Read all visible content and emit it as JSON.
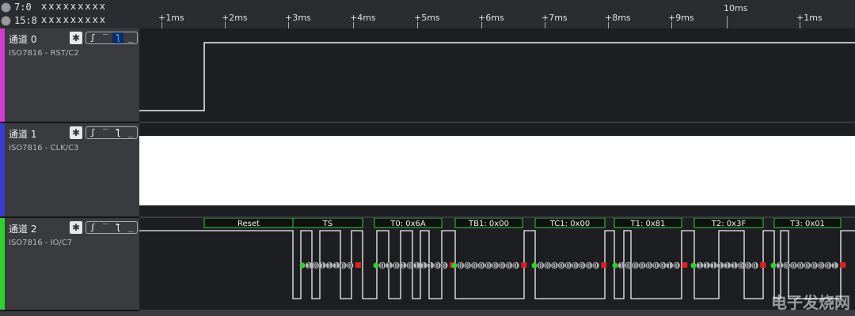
{
  "bus": [
    {
      "label": "7:0",
      "bits": "xxxxxxxxx"
    },
    {
      "label": "15:8",
      "bits": "xxxxxxxxx"
    }
  ],
  "ruler": {
    "ticks": [
      "+1ms",
      "+2ms",
      "+3ms",
      "+4ms",
      "+5ms",
      "+6ms",
      "+7ms",
      "+8ms",
      "+9ms",
      "10ms",
      "+1ms"
    ]
  },
  "channels": [
    {
      "name": "通道 0",
      "sub": "ISO7816 - RST/C2",
      "color": "#d23bd2"
    },
    {
      "name": "通道 1",
      "sub": "ISO7816 - CLK/C3",
      "color": "#3b3bd2"
    },
    {
      "name": "通道 2",
      "sub": "ISO7816 - IO/C7",
      "color": "#2fd12f"
    }
  ],
  "trigger_icons": [
    "rising-edge",
    "high",
    "falling-edge",
    "low"
  ],
  "protocol": {
    "frames": [
      "Reset",
      "TS",
      "T0: 0x6A",
      "TB1: 0x00",
      "TC1: 0x00",
      "T1: 0x81",
      "T2: 0x3F",
      "T3: 0x01"
    ],
    "bits": [
      "1011100",
      "0101011100",
      "000000000",
      "000000000",
      "100000010",
      "111111000",
      "100000001"
    ]
  },
  "watermark": "电子发烧网"
}
